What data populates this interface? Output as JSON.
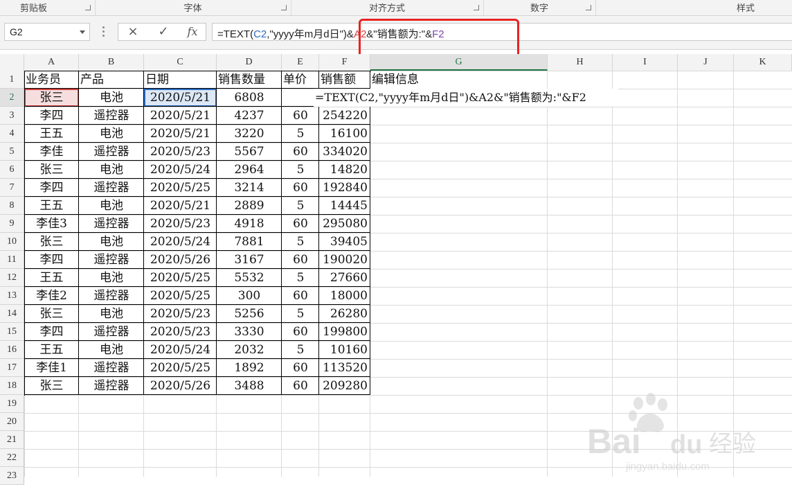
{
  "ribbon": {
    "groups": [
      "剪贴板",
      "字体",
      "对齐方式",
      "数字",
      "样式"
    ]
  },
  "formula_bar": {
    "name_box": "G2",
    "formula_parts": [
      {
        "text": "=TEXT(",
        "style": "plain"
      },
      {
        "text": "C2",
        "style": "ref-c"
      },
      {
        "text": ",\"yyyy年m月d日\")&",
        "style": "plain"
      },
      {
        "text": "A2",
        "style": "ref-a"
      },
      {
        "text": "&\"销售额为:\"&",
        "style": "plain"
      },
      {
        "text": "F2",
        "style": "ref-f"
      }
    ],
    "cancel_icon": "×",
    "enter_icon": "✓",
    "fx_icon": "fx"
  },
  "columns": [
    "A",
    "B",
    "C",
    "D",
    "E",
    "F",
    "G",
    "H",
    "I",
    "J",
    "K"
  ],
  "selected_column": "G",
  "rows": [
    "1",
    "2",
    "3",
    "4",
    "5",
    "6",
    "7",
    "8",
    "9",
    "10",
    "11",
    "12",
    "13",
    "14",
    "15",
    "16",
    "17",
    "18",
    "19",
    "20",
    "21",
    "22",
    "23"
  ],
  "selected_row": "2",
  "headers": [
    "业务员",
    "产品",
    "日期",
    "销售数量",
    "单价",
    "销售额",
    "编辑信息"
  ],
  "editing_formula": "=TEXT(C2,\"yyyy年m月d日\")&A2&\"销售额为:\"&F2",
  "table": [
    [
      "张三",
      "电池",
      "2020/5/21",
      "6808",
      "",
      ""
    ],
    [
      "李四",
      "遥控器",
      "2020/5/21",
      "4237",
      "60",
      "254220"
    ],
    [
      "王五",
      "电池",
      "2020/5/21",
      "3220",
      "5",
      "16100"
    ],
    [
      "李佳",
      "遥控器",
      "2020/5/23",
      "5567",
      "60",
      "334020"
    ],
    [
      "张三",
      "电池",
      "2020/5/24",
      "2964",
      "5",
      "14820"
    ],
    [
      "李四",
      "遥控器",
      "2020/5/25",
      "3214",
      "60",
      "192840"
    ],
    [
      "王五",
      "电池",
      "2020/5/21",
      "2889",
      "5",
      "14445"
    ],
    [
      "李佳3",
      "遥控器",
      "2020/5/23",
      "4918",
      "60",
      "295080"
    ],
    [
      "张三",
      "电池",
      "2020/5/24",
      "7881",
      "5",
      "39405"
    ],
    [
      "李四",
      "遥控器",
      "2020/5/26",
      "3167",
      "60",
      "190020"
    ],
    [
      "王五",
      "电池",
      "2020/5/25",
      "5532",
      "5",
      "27660"
    ],
    [
      "李佳2",
      "遥控器",
      "2020/5/25",
      "300",
      "60",
      "18000"
    ],
    [
      "张三",
      "电池",
      "2020/5/23",
      "5256",
      "5",
      "26280"
    ],
    [
      "李四",
      "遥控器",
      "2020/5/23",
      "3330",
      "60",
      "199800"
    ],
    [
      "王五",
      "电池",
      "2020/5/24",
      "2032",
      "5",
      "10160"
    ],
    [
      "李佳1",
      "遥控器",
      "2020/5/25",
      "1892",
      "60",
      "113520"
    ],
    [
      "张三",
      "遥控器",
      "2020/5/26",
      "3488",
      "60",
      "209280"
    ]
  ],
  "watermark": {
    "brand": "Bai",
    "brand2": "du",
    "cn": "经验",
    "url": "jingyan.baidu.com"
  },
  "colors": {
    "selection": "#217346",
    "ref_c": "#2d6cc0",
    "ref_a": "#d04040",
    "ref_f": "#7c45a8",
    "callout": "#e82222"
  }
}
